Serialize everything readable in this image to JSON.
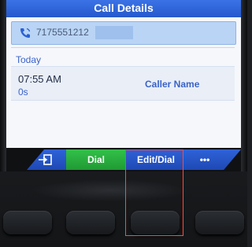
{
  "screen": {
    "title": "Call Details",
    "number": "7175551212",
    "section_label": "Today",
    "entry": {
      "time": "07:55 AM",
      "duration": "0s",
      "caller_name": "Caller Name"
    },
    "softkeys": {
      "dial": "Dial",
      "edit_dial": "Edit/Dial",
      "more": "•••"
    }
  },
  "icons": {
    "number": "phone-icon",
    "back": "back-icon",
    "more": "more-icon"
  },
  "colors": {
    "title_bar": "#2558cc",
    "dial_key": "#1f9a33",
    "softkey": "#1e49b4",
    "highlight": "#ff4a3a"
  }
}
